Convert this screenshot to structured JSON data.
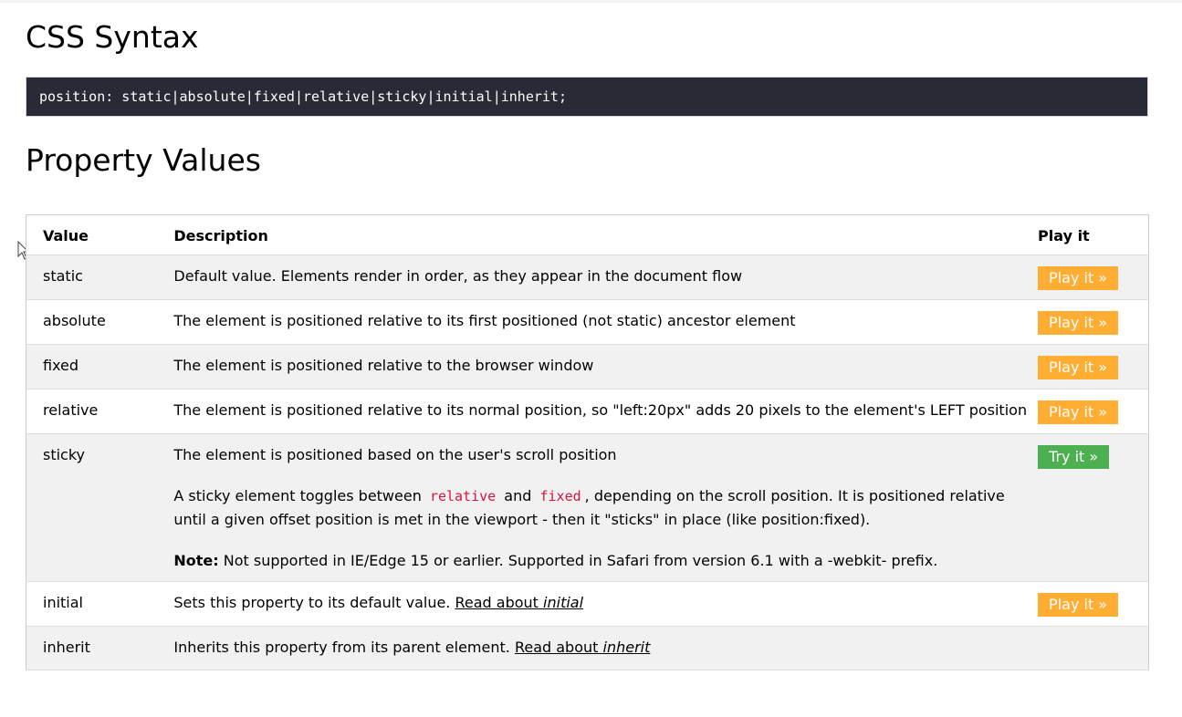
{
  "syntax": {
    "heading": "CSS Syntax",
    "code": "position: static|absolute|fixed|relative|sticky|initial|inherit;"
  },
  "values": {
    "heading": "Property Values",
    "columns": {
      "value": "Value",
      "description": "Description",
      "play": "Play it"
    },
    "rows": [
      {
        "value": "static",
        "description": "Default value. Elements render in order, as they appear in the document flow",
        "button": "Play it »"
      },
      {
        "value": "absolute",
        "description": "The element is positioned relative to its first positioned (not static) ancestor element",
        "button": "Play it »"
      },
      {
        "value": "fixed",
        "description": "The element is positioned relative to the browser window",
        "button": "Play it »"
      },
      {
        "value": "relative",
        "description": "The element is positioned relative to its normal position, so \"left:20px\" adds 20 pixels to the element's LEFT position",
        "button": "Play it »"
      },
      {
        "value": "sticky",
        "description": "The element is positioned based on the user's scroll position",
        "detail_before": "A sticky element toggles between",
        "code1": "relative",
        "detail_and": "and",
        "code2": "fixed",
        "detail_after": ", depending on the scroll position. It is positioned relative until a given offset position is met in the viewport - then it \"sticks\" in place (like position:fixed).",
        "note_label": "Note:",
        "note_text": " Not supported in IE/Edge 15 or earlier. Supported in Safari from version 6.1 with a -webkit- prefix.",
        "button": "Try it »"
      },
      {
        "value": "initial",
        "description": "Sets this property to its default value.",
        "link_text": "Read about",
        "link_em": "initial",
        "button": "Play it »"
      },
      {
        "value": "inherit",
        "description": "Inherits this property from its parent element.",
        "link_text": "Read about",
        "link_em": "inherit"
      }
    ]
  },
  "colors": {
    "play_button": "#ffad33",
    "try_button": "#4caf50",
    "code_bg": "#282a35",
    "inline_code": "#dc143c",
    "row_alt": "#f1f1f1"
  },
  "icons": {
    "cursor": "mouse-pointer-icon"
  }
}
